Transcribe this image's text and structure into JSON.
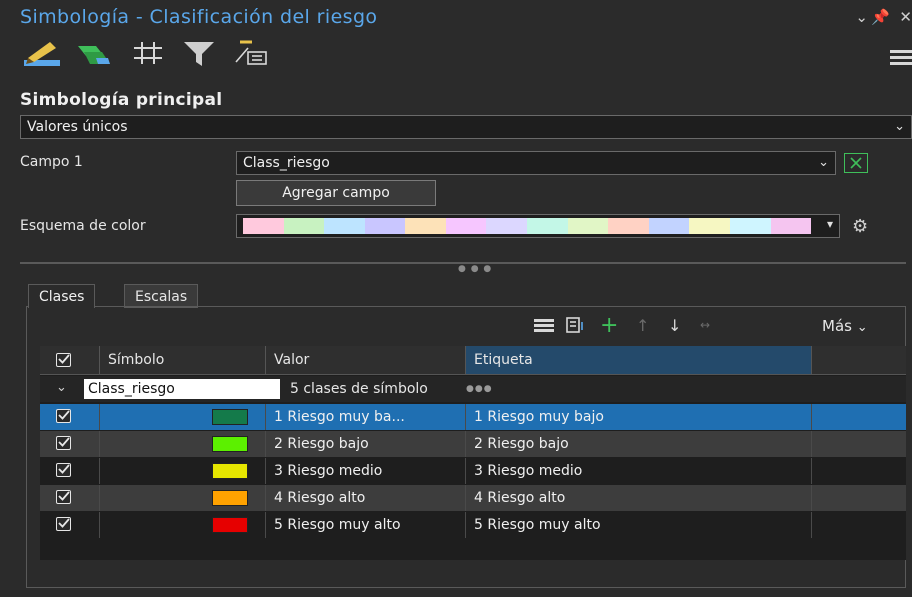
{
  "window": {
    "title": "Simbología - Clasificación del riesgo"
  },
  "toolbar": {
    "icons": [
      "primary-symbology-icon",
      "vary-symbology-icon",
      "labeling-icon",
      "filter-icon",
      "attribute-icon"
    ],
    "menu_icon": "hamburger-icon"
  },
  "primary": {
    "section_title": "Simbología principal",
    "method": "Valores únicos",
    "field_label": "Campo 1",
    "field_value": "Class_riesgo",
    "add_field_label": "Agregar campo",
    "color_scheme_label": "Esquema de color",
    "color_scheme": [
      "#ffc9dd",
      "#c8f2c1",
      "#bde4ff",
      "#c9c6ff",
      "#fde2b8",
      "#f6c6ff",
      "#dcd7ff",
      "#c3f7e7",
      "#e1f6c6",
      "#ffd2c4",
      "#c2d3ff",
      "#f6f7c2",
      "#cff5ff",
      "#f5c5f0"
    ]
  },
  "tabs": {
    "classes": "Clases",
    "scales": "Escalas"
  },
  "controls": {
    "more_label": "Más"
  },
  "table": {
    "columns": {
      "symbol": "Símbolo",
      "value": "Valor",
      "label": "Etiqueta"
    },
    "group": {
      "field": "Class_riesgo",
      "summary": "5 clases de símbolo",
      "ellipsis": "●●●"
    },
    "rows": [
      {
        "value": "1 Riesgo muy ba...",
        "label": "1 Riesgo muy bajo",
        "color": "#147a4a"
      },
      {
        "value": "2 Riesgo bajo",
        "label": "2 Riesgo bajo",
        "color": "#5cf000"
      },
      {
        "value": "3 Riesgo medio",
        "label": "3 Riesgo medio",
        "color": "#e6e600"
      },
      {
        "value": "4 Riesgo alto",
        "label": "4 Riesgo alto",
        "color": "#ffa200"
      },
      {
        "value": "5 Riesgo muy alto",
        "label": "5 Riesgo muy alto",
        "color": "#e60000"
      }
    ]
  },
  "colors": {
    "accent": "#5aa7ea",
    "selected_row": "#1f6fb2",
    "header_selected": "#244a6b"
  }
}
